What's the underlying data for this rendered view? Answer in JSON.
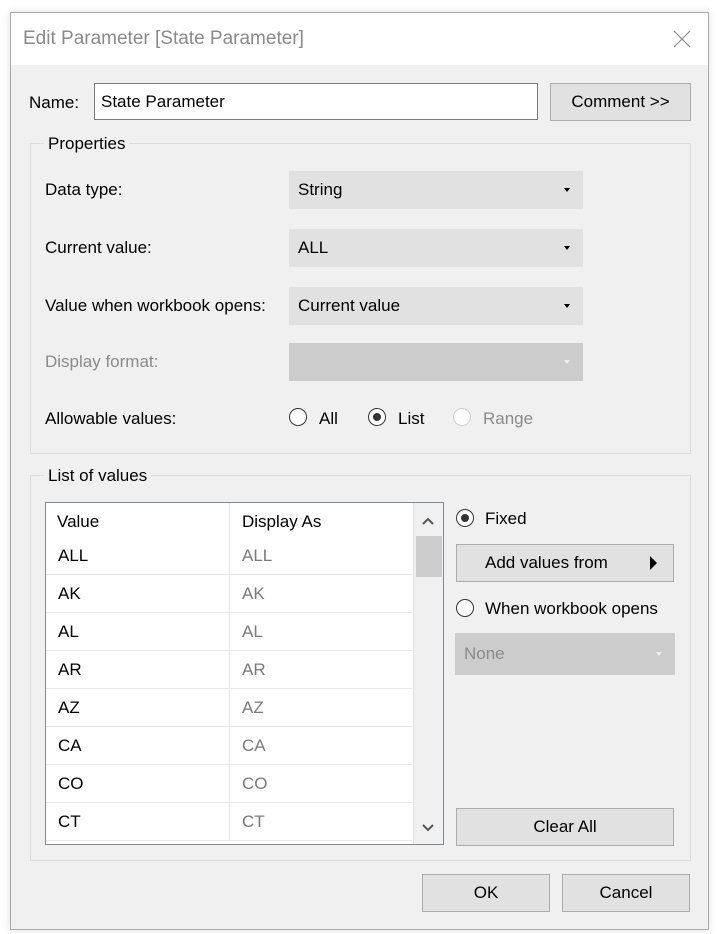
{
  "dialog": {
    "title": "Edit Parameter [State Parameter]",
    "close_icon": "close-icon"
  },
  "name": {
    "label": "Name:",
    "value": "State Parameter",
    "comment_button": "Comment >>"
  },
  "properties": {
    "title": "Properties",
    "data_type_label": "Data type:",
    "data_type_value": "String",
    "current_value_label": "Current value:",
    "current_value_value": "ALL",
    "workbook_opens_label": "Value when workbook opens:",
    "workbook_opens_value": "Current value",
    "display_format_label": "Display format:",
    "display_format_value": "",
    "allowable_values_label": "Allowable values:",
    "allowable_options": [
      {
        "label": "All",
        "checked": false,
        "enabled": true
      },
      {
        "label": "List",
        "checked": true,
        "enabled": true
      },
      {
        "label": "Range",
        "checked": false,
        "enabled": false
      }
    ]
  },
  "list_of_values": {
    "title": "List of values",
    "columns": [
      "Value",
      "Display As"
    ],
    "rows": [
      {
        "value": "ALL",
        "display": "ALL"
      },
      {
        "value": "AK",
        "display": "AK"
      },
      {
        "value": "AL",
        "display": "AL"
      },
      {
        "value": "AR",
        "display": "AR"
      },
      {
        "value": "AZ",
        "display": "AZ"
      },
      {
        "value": "CA",
        "display": "CA"
      },
      {
        "value": "CO",
        "display": "CO"
      },
      {
        "value": "CT",
        "display": "CT"
      }
    ],
    "fixed_label": "Fixed",
    "fixed_checked": true,
    "add_values_from_button": "Add values from",
    "when_workbook_opens_label": "When workbook opens",
    "when_workbook_opens_checked": false,
    "when_workbook_opens_value": "None",
    "clear_all_button": "Clear All"
  },
  "footer": {
    "ok_button": "OK",
    "cancel_button": "Cancel"
  }
}
